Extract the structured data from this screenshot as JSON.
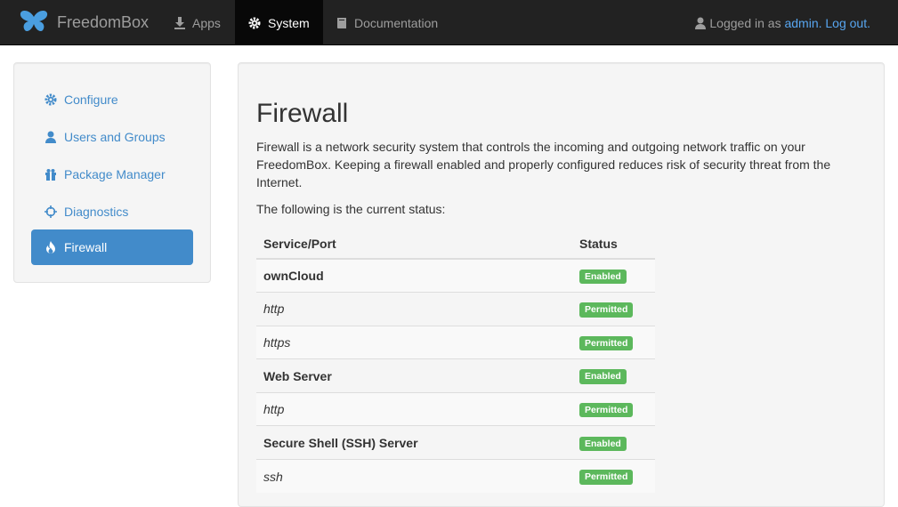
{
  "navbar": {
    "brand": "FreedomBox",
    "apps": "Apps",
    "system": "System",
    "documentation": "Documentation",
    "user_prefix": "Logged in as",
    "user_name": "admin.",
    "logout": "Log out."
  },
  "sidebar": {
    "items": [
      {
        "label": "Configure",
        "icon": "gear-icon"
      },
      {
        "label": "Users and Groups",
        "icon": "user-icon"
      },
      {
        "label": "Package Manager",
        "icon": "gift-icon"
      },
      {
        "label": "Diagnostics",
        "icon": "crosshair-icon"
      },
      {
        "label": "Firewall",
        "icon": "fire-icon",
        "active": true
      }
    ]
  },
  "main": {
    "title": "Firewall",
    "description": "Firewall is a network security system that controls the incoming and outgoing network traffic on your FreedomBox. Keeping a firewall enabled and properly configured reduces risk of security threat from the Internet.",
    "status_intro": "The following is the current status:",
    "table": {
      "headers": [
        "Service/Port",
        "Status"
      ],
      "rows": [
        {
          "name": "ownCloud",
          "kind": "service",
          "status": "Enabled"
        },
        {
          "name": "http",
          "kind": "port",
          "status": "Permitted"
        },
        {
          "name": "https",
          "kind": "port",
          "status": "Permitted"
        },
        {
          "name": "Web Server",
          "kind": "service",
          "status": "Enabled"
        },
        {
          "name": "http",
          "kind": "port",
          "status": "Permitted"
        },
        {
          "name": "Secure Shell (SSH) Server",
          "kind": "service",
          "status": "Enabled"
        },
        {
          "name": "ssh",
          "kind": "port",
          "status": "Permitted"
        }
      ]
    }
  },
  "colors": {
    "navbar_bg": "#222222",
    "link": "#428bca",
    "label_success": "#5cb85c"
  }
}
